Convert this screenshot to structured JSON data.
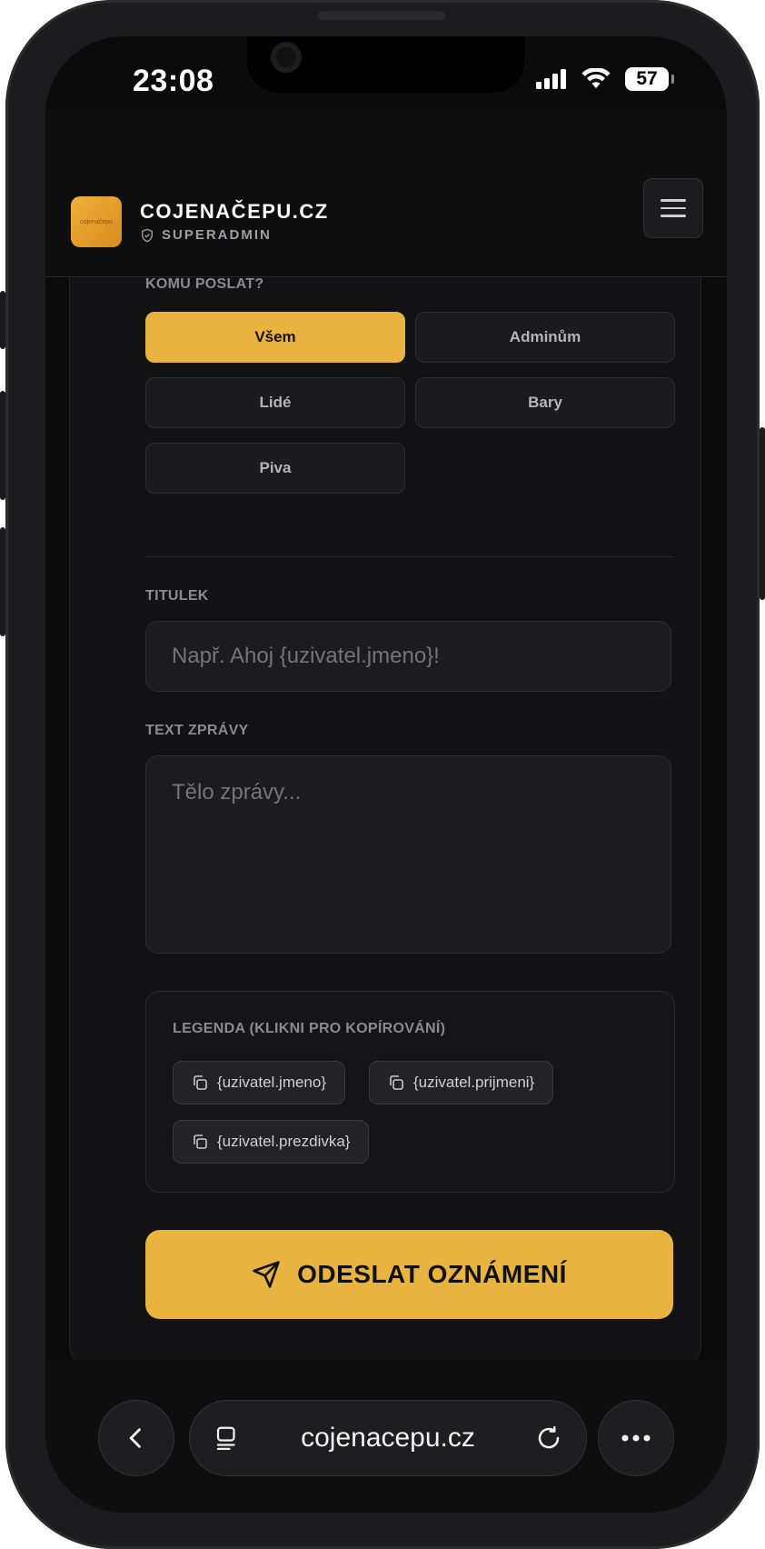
{
  "status_bar": {
    "time": "23:08",
    "battery": "57"
  },
  "header": {
    "logo_text": "cojenačepu",
    "brand": "COJENAČEPU.CZ",
    "role": "SUPERADMIN"
  },
  "form": {
    "recipients_label": "KOMU POSLAT?",
    "options": [
      "Všem",
      "Adminům",
      "Lidé",
      "Bary",
      "Piva"
    ],
    "selected_option": "Všem",
    "title_label": "TITULEK",
    "title_placeholder": "Např. Ahoj {uzivatel.jmeno}!",
    "message_label": "TEXT ZPRÁVY",
    "message_placeholder": "Tělo zprávy...",
    "legend_label": "LEGENDA (KLIKNI PRO KOPÍROVÁNÍ)",
    "legend_chips": [
      "{uzivatel.jmeno}",
      "{uzivatel.prijmeni}",
      "{uzivatel.prezdivka}"
    ],
    "send_label": "ODESLAT OZNÁMENÍ"
  },
  "browser": {
    "url": "cojenacepu.cz"
  },
  "icons": {
    "shield": "shield-check-icon",
    "menu": "hamburger-icon",
    "copy": "copy-icon",
    "send": "paper-plane-icon",
    "back": "chevron-left-icon",
    "tabs": "tabs-icon",
    "reload": "reload-icon",
    "more": "ellipsis-icon"
  },
  "colors": {
    "accent": "#e8b33f",
    "background": "#0b0b0c",
    "card": "#121214"
  }
}
